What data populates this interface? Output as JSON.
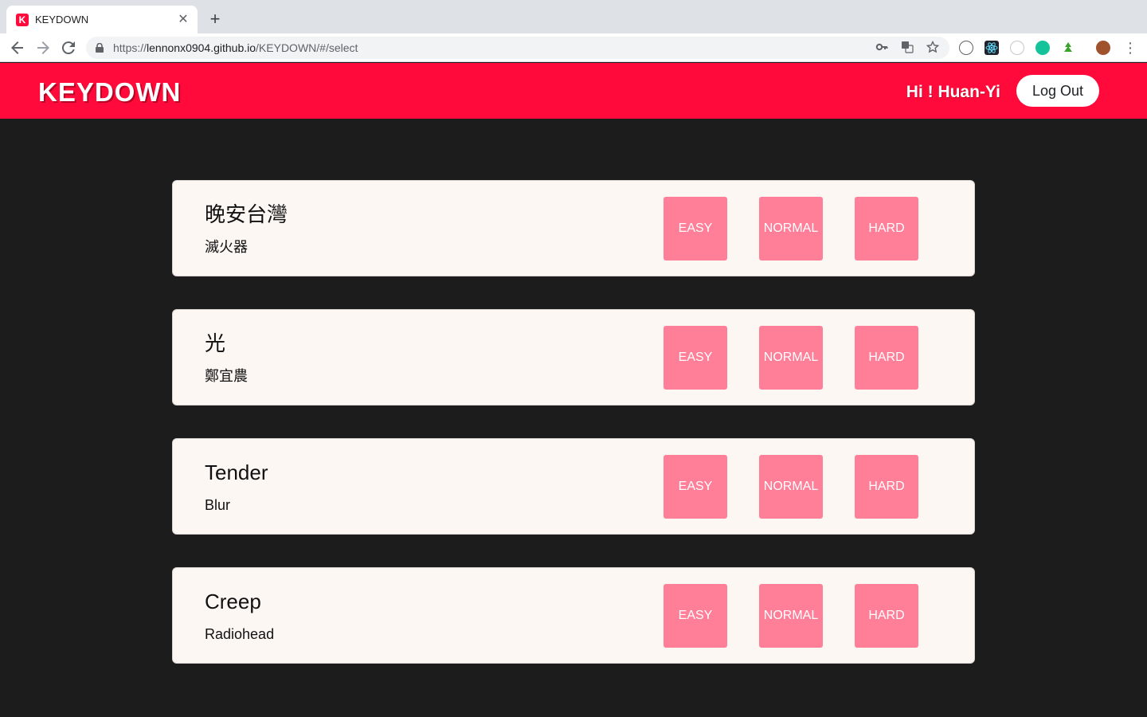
{
  "browser": {
    "tab_title": "KEYDOWN",
    "favicon_letter": "K",
    "url_prefix": "https://",
    "url_host": "lennonx0904.github.io",
    "url_path": "/KEYDOWN/#/select"
  },
  "app": {
    "logo": "KEYDOWN",
    "greeting": "Hi ! Huan-Yi",
    "logout_label": "Log Out",
    "brand_color": "#ff0a3a",
    "button_color": "#ff7f99"
  },
  "songs": [
    {
      "title": "晚安台灣",
      "artist": "滅火器",
      "easy": "EASY",
      "normal": "NORMAL",
      "hard": "HARD"
    },
    {
      "title": "光",
      "artist": "鄭宜農",
      "easy": "EASY",
      "normal": "NORMAL",
      "hard": "HARD"
    },
    {
      "title": "Tender",
      "artist": "Blur",
      "easy": "EASY",
      "normal": "NORMAL",
      "hard": "HARD"
    },
    {
      "title": "Creep",
      "artist": "Radiohead",
      "easy": "EASY",
      "normal": "NORMAL",
      "hard": "HARD"
    }
  ]
}
